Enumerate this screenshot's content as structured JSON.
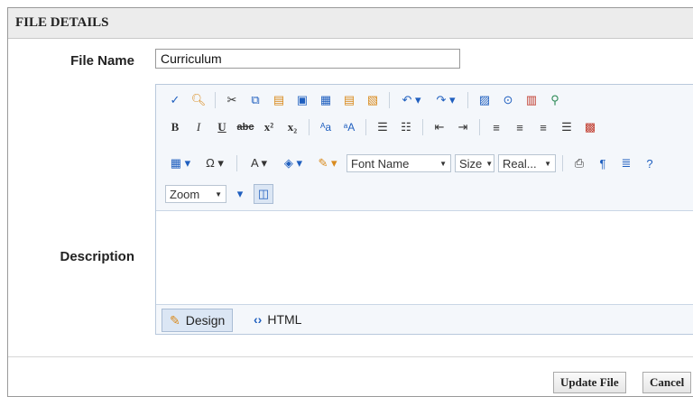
{
  "panel": {
    "title": "FILE DETAILS"
  },
  "file_name": {
    "label": "File Name",
    "value": "Curriculum"
  },
  "description": {
    "label": "Description"
  },
  "editor": {
    "combos": {
      "font_name": "Font Name",
      "size": "Size",
      "real": "Real...",
      "zoom": "Zoom"
    },
    "tabs": {
      "design": "Design",
      "html": "HTML"
    },
    "icons": {
      "row1": [
        "spellcheck-icon",
        "find-icon",
        "cut-icon",
        "copy-icon",
        "paste-icon",
        "paste-from-word-icon",
        "paste-plain-text-icon",
        "paste-html-icon",
        "paste-as-html-icon",
        "undo-icon",
        "redo-icon",
        "image-manager-icon",
        "media-manager-icon",
        "document-manager-icon",
        "hyperlink-manager-icon"
      ],
      "row2": [
        "bold-icon",
        "italic-icon",
        "underline-icon",
        "strikethrough-icon",
        "superscript-icon",
        "subscript-icon",
        "uppercase-icon",
        "lowercase-icon",
        "ordered-list-icon",
        "unordered-list-icon",
        "outdent-icon",
        "indent-icon",
        "align-left-icon",
        "align-center-icon",
        "align-right-icon",
        "justify-icon",
        "remove-alignment-icon"
      ]
    }
  },
  "buttons": {
    "update": "Update File",
    "cancel": "Cancel"
  }
}
